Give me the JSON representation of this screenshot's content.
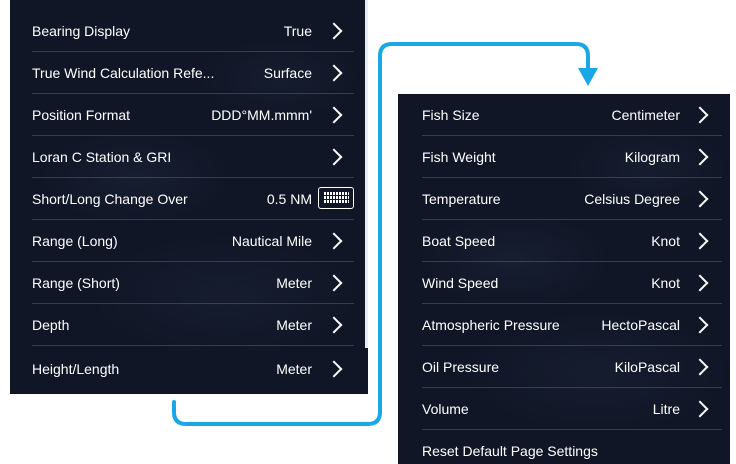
{
  "left_menu": {
    "rows": [
      {
        "label": "Bearing Display",
        "value": "True",
        "control": "chevron"
      },
      {
        "label": "True Wind Calculation Refe...",
        "value": "Surface",
        "control": "chevron"
      },
      {
        "label": "Position Format",
        "value": "DDD°MM.mmm'",
        "control": "chevron"
      },
      {
        "label": "Loran C Station & GRI",
        "value": "",
        "control": "chevron"
      },
      {
        "label": "Short/Long Change Over",
        "value": "0.5 NM",
        "control": "keyboard"
      },
      {
        "label": "Range (Long)",
        "value": "Nautical Mile",
        "control": "chevron"
      },
      {
        "label": "Range (Short)",
        "value": "Meter",
        "control": "chevron"
      },
      {
        "label": "Depth",
        "value": "Meter",
        "control": "chevron"
      },
      {
        "label": "Height/Length",
        "value": "Meter",
        "control": "chevron"
      }
    ]
  },
  "right_menu": {
    "rows": [
      {
        "label": "Fish Size",
        "value": "Centimeter",
        "control": "chevron"
      },
      {
        "label": "Fish Weight",
        "value": "Kilogram",
        "control": "chevron"
      },
      {
        "label": "Temperature",
        "value": "Celsius Degree",
        "control": "chevron"
      },
      {
        "label": "Boat Speed",
        "value": "Knot",
        "control": "chevron"
      },
      {
        "label": "Wind Speed",
        "value": "Knot",
        "control": "chevron"
      },
      {
        "label": "Atmospheric Pressure",
        "value": "HectoPascal",
        "control": "chevron"
      },
      {
        "label": "Oil Pressure",
        "value": "KiloPascal",
        "control": "chevron"
      },
      {
        "label": "Volume",
        "value": "Litre",
        "control": "chevron"
      },
      {
        "label": "Reset Default Page Settings",
        "value": "",
        "control": "none"
      }
    ]
  },
  "colors": {
    "panel_bg": "#101626",
    "text": "#ffffff",
    "connector": "#1aa7e6"
  },
  "icons": [
    "chevron-right-icon",
    "keyboard-icon",
    "arrow-down-icon"
  ]
}
